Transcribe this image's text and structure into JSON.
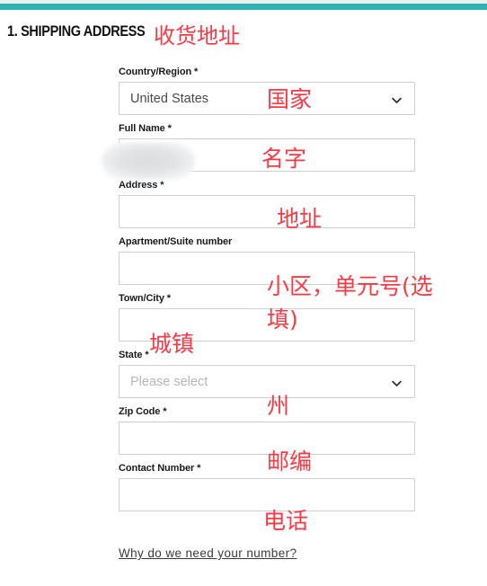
{
  "theme": {
    "accent_teal": "#2eb4b5",
    "annotation_red": "#f93a45",
    "field_border": "#cfcfcf",
    "label_color": "#1a1a1a",
    "placeholder_color": "#b6b6b6"
  },
  "header": {
    "section_title": "1. SHIPPING ADDRESS",
    "section_title_annotation": "收货地址"
  },
  "form": {
    "fields": [
      {
        "key": "country",
        "label": "Country/Region *",
        "type": "select",
        "value": "United States",
        "placeholder": "",
        "is_placeholder": false,
        "has_chevron": true,
        "annotation": "国家"
      },
      {
        "key": "full_name",
        "label": "Full Name *",
        "type": "text",
        "value": "",
        "placeholder": "",
        "is_placeholder": false,
        "has_chevron": false,
        "annotation": "名字",
        "redacted": true
      },
      {
        "key": "address",
        "label": "Address *",
        "type": "text",
        "value": "",
        "placeholder": "",
        "is_placeholder": false,
        "has_chevron": false,
        "annotation": "地址"
      },
      {
        "key": "apartment",
        "label": "Apartment/Suite number",
        "type": "text",
        "value": "",
        "placeholder": "",
        "is_placeholder": false,
        "has_chevron": false,
        "annotation": "小区，单元号(选\n填)"
      },
      {
        "key": "town_city",
        "label": "Town/City *",
        "type": "text",
        "value": "",
        "placeholder": "",
        "is_placeholder": false,
        "has_chevron": false,
        "annotation": "城镇"
      },
      {
        "key": "state",
        "label": "State *",
        "type": "select",
        "value": "Please select",
        "placeholder": "Please select",
        "is_placeholder": true,
        "has_chevron": true,
        "annotation": "州"
      },
      {
        "key": "zip_code",
        "label": "Zip Code *",
        "type": "text",
        "value": "",
        "placeholder": "",
        "is_placeholder": false,
        "has_chevron": false,
        "annotation": "邮编"
      },
      {
        "key": "contact_number",
        "label": "Contact Number *",
        "type": "text",
        "value": "",
        "placeholder": "",
        "is_placeholder": false,
        "has_chevron": false,
        "annotation": "电话"
      }
    ],
    "help_link": "Why do we need your number?"
  },
  "icons": {
    "chevron_down": "chevron-down-icon"
  }
}
